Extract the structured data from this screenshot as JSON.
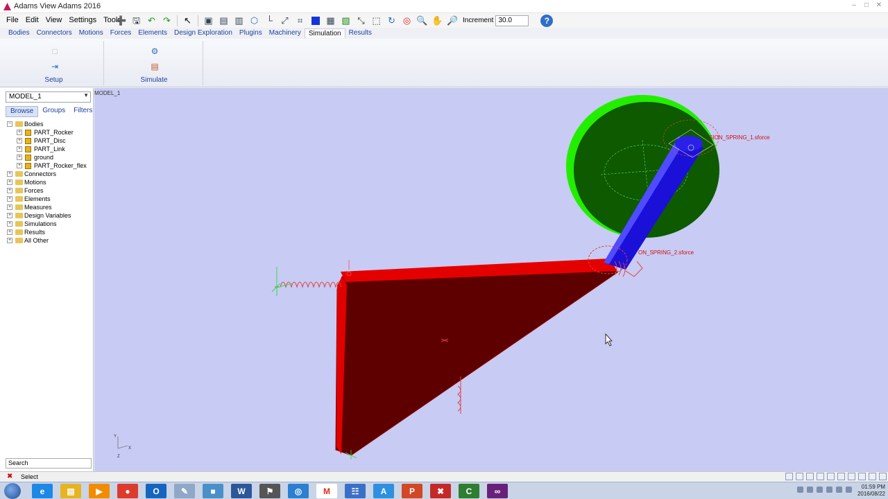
{
  "window": {
    "title": "Adams View Adams 2016"
  },
  "menu": {
    "items": [
      "File",
      "Edit",
      "View",
      "Settings",
      "Tools"
    ]
  },
  "toolbar": {
    "increment_label": "Increment",
    "increment_value": "30.0",
    "help": "?"
  },
  "ribbon": {
    "tabs": [
      "Bodies",
      "Connectors",
      "Motions",
      "Forces",
      "Elements",
      "Design Exploration",
      "Plugins",
      "Machinery",
      "Simulation",
      "Results"
    ],
    "active_tab": "Simulation",
    "groups": [
      {
        "label": "Setup"
      },
      {
        "label": "Simulate"
      }
    ]
  },
  "browser": {
    "model_name": "MODEL_1",
    "tabs": [
      "Browse",
      "Groups",
      "Filters"
    ],
    "tree": [
      {
        "label": "Bodies",
        "level": 0,
        "type": "folder",
        "expanded": true
      },
      {
        "label": "PART_Rocker",
        "level": 1,
        "type": "part"
      },
      {
        "label": "PART_Disc",
        "level": 1,
        "type": "part"
      },
      {
        "label": "PART_Link",
        "level": 1,
        "type": "part"
      },
      {
        "label": "ground",
        "level": 1,
        "type": "part"
      },
      {
        "label": "PART_Rocker_flex",
        "level": 1,
        "type": "part"
      },
      {
        "label": "Connectors",
        "level": 0,
        "type": "folder"
      },
      {
        "label": "Motions",
        "level": 0,
        "type": "folder"
      },
      {
        "label": "Forces",
        "level": 0,
        "type": "folder"
      },
      {
        "label": "Elements",
        "level": 0,
        "type": "folder"
      },
      {
        "label": "Measures",
        "level": 0,
        "type": "folder"
      },
      {
        "label": "Design Variables",
        "level": 0,
        "type": "folder"
      },
      {
        "label": "Simulations",
        "level": 0,
        "type": "folder"
      },
      {
        "label": "Results",
        "level": 0,
        "type": "folder"
      },
      {
        "label": "All Other",
        "level": 0,
        "type": "folder"
      }
    ],
    "search_label": "Search"
  },
  "viewport": {
    "model_label": "MODEL_1",
    "annotations": [
      "SION_SPRING_1.sforce",
      "ON_SPRING_2.sforce"
    ],
    "triad": {
      "y": "Y",
      "x": "X",
      "z": "Z"
    },
    "colors": {
      "background": "#c8cbf3",
      "rocker": "#5e0000",
      "rocker_edge": "#e60000",
      "disc": "#0d5a00",
      "disc_rim": "#22ee00",
      "link": "#1a10d8",
      "annotation": "#cc1111"
    }
  },
  "status": {
    "text": "Select"
  },
  "taskbar": {
    "apps": [
      "ie-icon",
      "explorer-icon",
      "media-icon",
      "chrome-icon",
      "outlook-icon",
      "paint-icon",
      "files-icon",
      "word-icon",
      "wolf-icon",
      "ring-icon",
      "gmail-icon",
      "calculator-icon",
      "adams-icon",
      "powerpoint-icon",
      "adams-red-icon",
      "cam-icon",
      "vs-icon"
    ],
    "time": "01:59 PM",
    "date": "2016/08/22"
  }
}
